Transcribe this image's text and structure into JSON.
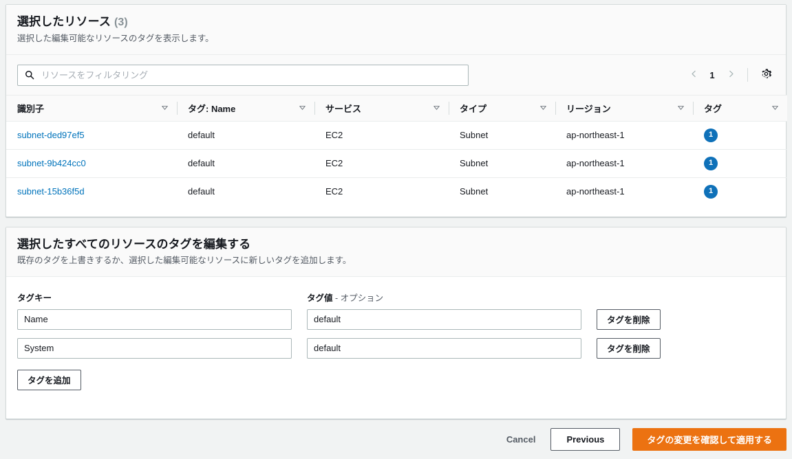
{
  "resources_panel": {
    "title": "選択したリソース",
    "count": "(3)",
    "description": "選択した編集可能なリソースのタグを表示します。",
    "filter": {
      "placeholder": "リソースをフィルタリング",
      "value": "",
      "icon": "search-icon"
    },
    "pagination": {
      "prev_icon": "chevron-left-icon",
      "next_icon": "chevron-right-icon",
      "current_page": "1",
      "settings_icon": "gear-icon"
    },
    "table": {
      "columns": [
        {
          "label": "識別子",
          "sort_icon": "sort-descending-icon"
        },
        {
          "label": "タグ: Name",
          "sort_icon": "sort-descending-icon"
        },
        {
          "label": "サービス",
          "sort_icon": "sort-descending-icon"
        },
        {
          "label": "タイプ",
          "sort_icon": "sort-descending-icon"
        },
        {
          "label": "リージョン",
          "sort_icon": "sort-descending-icon"
        },
        {
          "label": "タグ",
          "sort_icon": "sort-descending-icon"
        }
      ],
      "rows": [
        {
          "identifier": "subnet-ded97ef5",
          "tag_name": "default",
          "service": "EC2",
          "type": "Subnet",
          "region": "ap-northeast-1",
          "tags": "1"
        },
        {
          "identifier": "subnet-9b424cc0",
          "tag_name": "default",
          "service": "EC2",
          "type": "Subnet",
          "region": "ap-northeast-1",
          "tags": "1"
        },
        {
          "identifier": "subnet-15b36f5d",
          "tag_name": "default",
          "service": "EC2",
          "type": "Subnet",
          "region": "ap-northeast-1",
          "tags": "1"
        }
      ]
    }
  },
  "edit_panel": {
    "title": "選択したすべてのリソースのタグを編集する",
    "description": "既存のタグを上書きするか、選択した編集可能なリソースに新しいタグを追加します。",
    "labels": {
      "key": "タグキー",
      "value": "タグ値",
      "value_optional": "- オプション"
    },
    "tag_rows": [
      {
        "key": "Name",
        "value": "default",
        "remove_label": "タグを削除"
      },
      {
        "key": "System",
        "value": "default",
        "remove_label": "タグを削除"
      }
    ],
    "add_tag_label": "タグを追加"
  },
  "footer": {
    "cancel_label": "Cancel",
    "previous_label": "Previous",
    "submit_label": "タグの変更を確認して適用する"
  },
  "colors": {
    "accent_orange": "#ec7211",
    "link_blue": "#0073bb",
    "badge_blue": "#0f71b9",
    "page_background": "#f1f3f3",
    "card_background": "#ffffff",
    "header_background": "#fafafa",
    "border": "#d5dbdb"
  }
}
